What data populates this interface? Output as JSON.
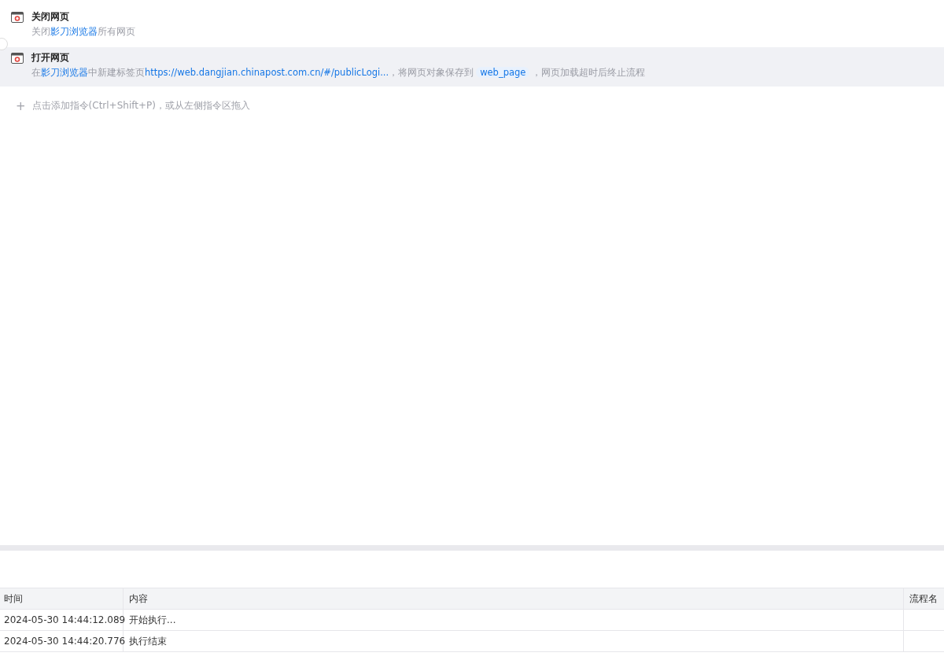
{
  "steps": [
    {
      "title": "关闭网页",
      "selected": false,
      "description": [
        {
          "kind": "plain",
          "text": "关闭"
        },
        {
          "kind": "link",
          "text": "影刀浏览器"
        },
        {
          "kind": "plain",
          "text": "所有网页"
        }
      ]
    },
    {
      "title": "打开网页",
      "selected": true,
      "description": [
        {
          "kind": "plain",
          "text": "在"
        },
        {
          "kind": "link",
          "text": "影刀浏览器"
        },
        {
          "kind": "plain",
          "text": "中新建标签页"
        },
        {
          "kind": "link",
          "text": "https://web.dangjian.chinapost.com.cn/#/publicLogi..."
        },
        {
          "kind": "plain",
          "text": "，将网页对象保存到"
        },
        {
          "kind": "var",
          "text": "web_page"
        },
        {
          "kind": "plain",
          "text": "，网页加载超时后终止流程"
        }
      ]
    }
  ],
  "add_hint": {
    "icon": "+",
    "text": "点击添加指令(Ctrl+Shift+P)，或从左侧指令区拖入"
  },
  "log_table": {
    "columns": [
      "时间",
      "内容",
      "流程名"
    ],
    "rows": [
      [
        "2024-05-30 14:44:12.089",
        "开始执行..."
      ],
      [
        "2024-05-30 14:44:20.776",
        "执行结束"
      ]
    ]
  }
}
